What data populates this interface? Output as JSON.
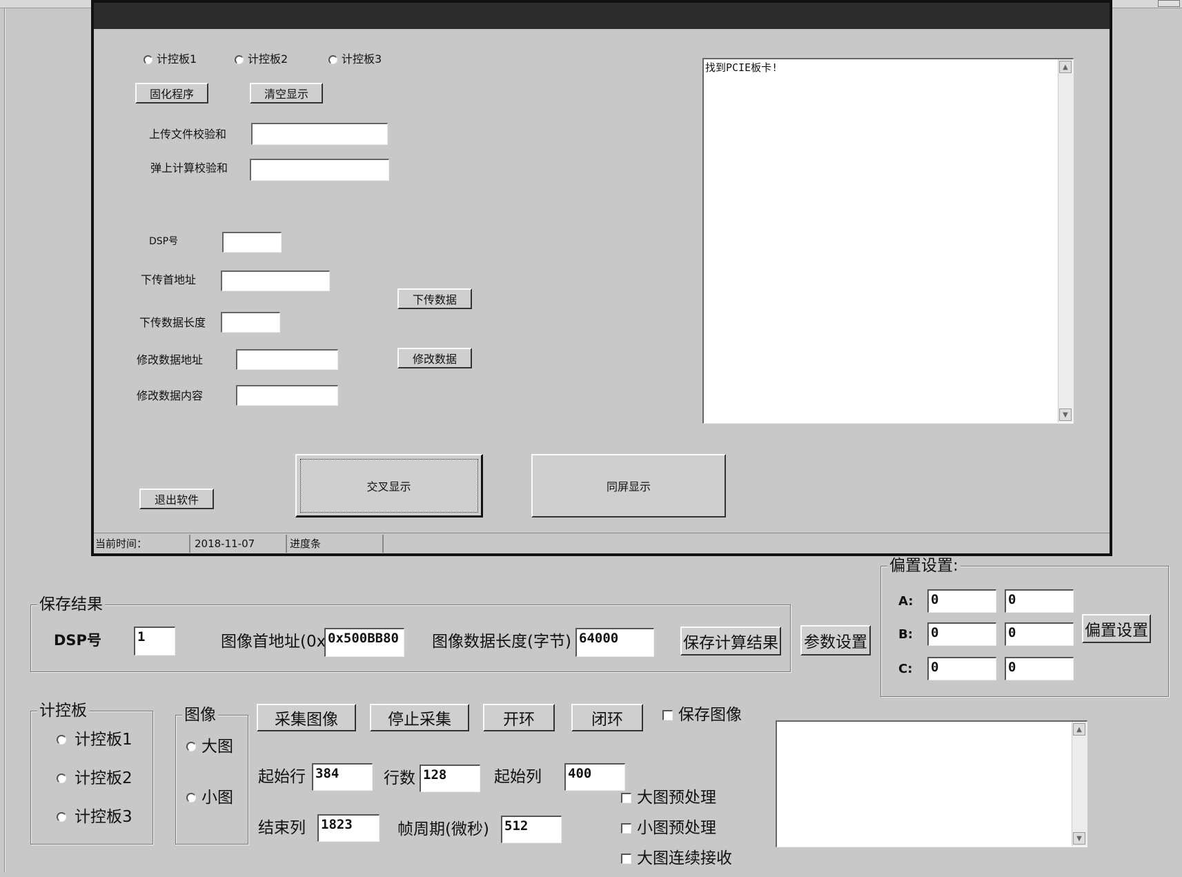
{
  "dialog": {
    "radios": [
      "计控板1",
      "计控板2",
      "计控板3"
    ],
    "buttons": {
      "firmware": "固化程序",
      "clear": "清空显示",
      "download": "下传数据",
      "modify": "修改数据",
      "cross_display": "交叉显示",
      "same_screen": "同屏显示",
      "exit": "退出软件"
    },
    "labels": {
      "upload_checksum": "上传文件校验和",
      "onboard_checksum": "弹上计算校验和",
      "dsp_no": "DSP号",
      "download_addr": "下传首地址",
      "download_len": "下传数据长度",
      "modify_addr": "修改数据地址",
      "modify_content": "修改数据内容"
    },
    "log_text": "找到PCIE板卡!",
    "status": {
      "time_label": "当前时间：",
      "date": "2018-11-07",
      "progress_label": "进度条"
    }
  },
  "bias": {
    "group_label": "偏置设置:",
    "rows": [
      {
        "label": "A:",
        "v1": "0",
        "v2": "0"
      },
      {
        "label": "B:",
        "v1": "0",
        "v2": "0"
      },
      {
        "label": "C:",
        "v1": "0",
        "v2": "0"
      }
    ],
    "button": "偏置设置"
  },
  "save": {
    "group_label": "保存结果",
    "dsp_label": "DSP号",
    "dsp_value": "1",
    "addr_label": "图像首地址(0x",
    "addr_value": "0x500BB80",
    "len_label": "图像数据长度(字节)",
    "len_value": "64000",
    "save_button": "保存计算结果"
  },
  "param_button": "参数设置",
  "board": {
    "group_label": "计控板",
    "options": [
      "计控板1",
      "计控板2",
      "计控板3"
    ]
  },
  "image": {
    "group_label": "图像",
    "options": [
      "大图",
      "小图"
    ]
  },
  "acq": {
    "buttons": {
      "capture": "采集图像",
      "stop": "停止采集",
      "open_loop": "开环",
      "close_loop": "闭环"
    },
    "save_image": "保存图像",
    "start_row_label": "起始行",
    "start_row": "384",
    "rows_label": "行数",
    "rows": "128",
    "start_col_label": "起始列",
    "start_col": "400",
    "end_col_label": "结束列",
    "end_col": "1823",
    "frame_label": "帧周期(微秒)",
    "frame": "512",
    "checks": [
      "大图预处理",
      "小图预处理",
      "大图连续接收"
    ]
  }
}
